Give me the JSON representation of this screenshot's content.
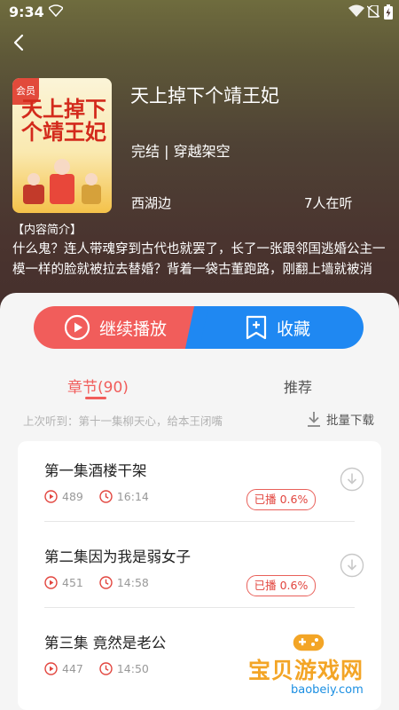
{
  "status_bar": {
    "time": "9:34"
  },
  "book": {
    "cover_tag": "会员",
    "cover_title": "天上掉下个靖王妃",
    "title": "天上掉下个靖王妃",
    "genre": "完结 | 穿越架空",
    "author": "西湖边",
    "listeners": "7人在听",
    "intro_label": "【内容简介】",
    "intro": "什么鬼？连人带魂穿到古代也就罢了，长了一张跟邻国逃婚公主一模一样的脸就被拉去替婚？背着一袋古董跑路，刚翻上墙就被消失..."
  },
  "actions": {
    "play_label": "继续播放",
    "fav_label": "收藏"
  },
  "tabs": {
    "chapters": "章节(90)",
    "recommend": "推荐"
  },
  "last_listened": "上次听到：第十一集柳天心，给本王闭嘴",
  "batch_download": "批量下载",
  "episodes": [
    {
      "title": "第一集酒楼干架",
      "plays": "489",
      "duration": "16:14",
      "progress": "已播 0.6%"
    },
    {
      "title": "第二集因为我是弱女子",
      "plays": "451",
      "duration": "14:58",
      "progress": "已播 0.6%"
    },
    {
      "title": "第三集 竟然是老公",
      "plays": "447",
      "duration": "14:50",
      "progress": ""
    }
  ],
  "watermark": {
    "text": "宝贝游戏网",
    "url": "baobeiy.com"
  },
  "colors": {
    "accent_red": "#f15d5b",
    "accent_blue": "#1f88f2"
  }
}
